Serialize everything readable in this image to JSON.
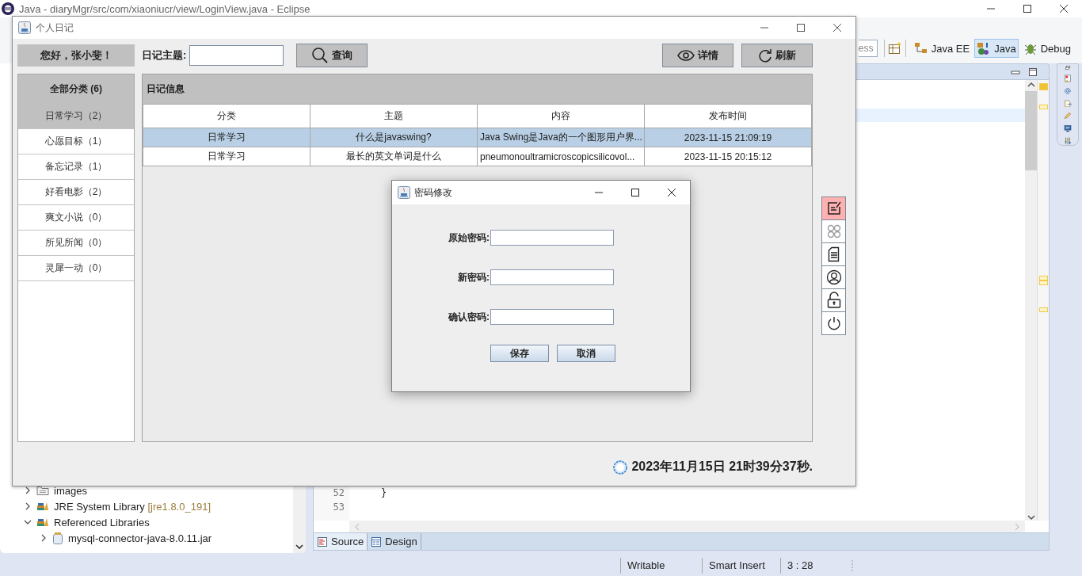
{
  "ide": {
    "title": "Java - diaryMgr/src/com/xiaoniucr/view/LoginView.java - Eclipse",
    "quick_access": "ess",
    "perspectives": [
      {
        "label": "Java EE",
        "selected": false
      },
      {
        "label": "Java",
        "selected": true
      },
      {
        "label": "Debug",
        "selected": false
      }
    ],
    "tree": [
      {
        "label": "images",
        "kind": "folder",
        "expanded": false
      },
      {
        "label": "JRE System Library",
        "decoration": "[jre1.8.0_191]",
        "kind": "library",
        "expanded": false
      },
      {
        "label": "Referenced Libraries",
        "kind": "library",
        "expanded": true,
        "children": [
          {
            "label": "mysql-connector-java-8.0.11.jar",
            "kind": "jar",
            "expanded": false
          }
        ]
      }
    ],
    "editor": {
      "lines": [
        {
          "number": "52",
          "code": "}"
        },
        {
          "number": "53"
        }
      ],
      "tabs": [
        {
          "label": "Source",
          "selected": true
        },
        {
          "label": "Design",
          "selected": false
        }
      ]
    },
    "status_bar": [
      "Writable",
      "Smart Insert",
      "3 : 28"
    ]
  },
  "app": {
    "title": "个人日记",
    "greeting": "您好，张小斐！",
    "search_label": "日记主题:",
    "buttons": [
      {
        "label": "查询",
        "kind": "search"
      },
      {
        "label": "详情",
        "kind": "view"
      },
      {
        "label": "刷新",
        "kind": "refresh"
      }
    ],
    "categories": {
      "header": "全部分类 (6)",
      "items": [
        {
          "label": "日常学习（2）",
          "selected": true
        },
        {
          "label": "心愿目标（1）",
          "selected": false
        },
        {
          "label": "备忘记录（1）",
          "selected": false
        },
        {
          "label": "好看电影（2）",
          "selected": false
        },
        {
          "label": "爽文小说（0）",
          "selected": false
        },
        {
          "label": "所见所闻（0）",
          "selected": false
        },
        {
          "label": "灵犀一动（0）",
          "selected": false
        }
      ]
    },
    "panel_title": "日记信息",
    "table": {
      "columns": [
        "分类",
        "主题",
        "内容",
        "发布时间"
      ],
      "rows": [
        {
          "cells": [
            "日常学习",
            "什么是javaswing?",
            "Java Swing是Java的一个图形用户界...",
            "2023-11-15 21:09:19"
          ],
          "selected": true
        },
        {
          "cells": [
            "日常学习",
            "最长的英文单词是什么",
            "pneumonoultramicroscopicsilicovol...",
            "2023-11-15 20:15:12"
          ],
          "selected": false
        }
      ]
    },
    "tools": [
      {
        "kind": "edit",
        "selected": true
      },
      {
        "kind": "clover",
        "selected": false
      },
      {
        "kind": "document",
        "selected": false
      },
      {
        "kind": "user",
        "selected": false
      },
      {
        "kind": "lock",
        "selected": false
      },
      {
        "kind": "power",
        "selected": false
      }
    ],
    "clock": "2023年11月15日 21时39分37秒."
  },
  "dialog": {
    "title": "密码修改",
    "fields": [
      {
        "label": "原始密码:"
      },
      {
        "label": "新密码:"
      },
      {
        "label": "确认密码:"
      }
    ],
    "buttons": [
      "保存",
      "取消"
    ]
  }
}
